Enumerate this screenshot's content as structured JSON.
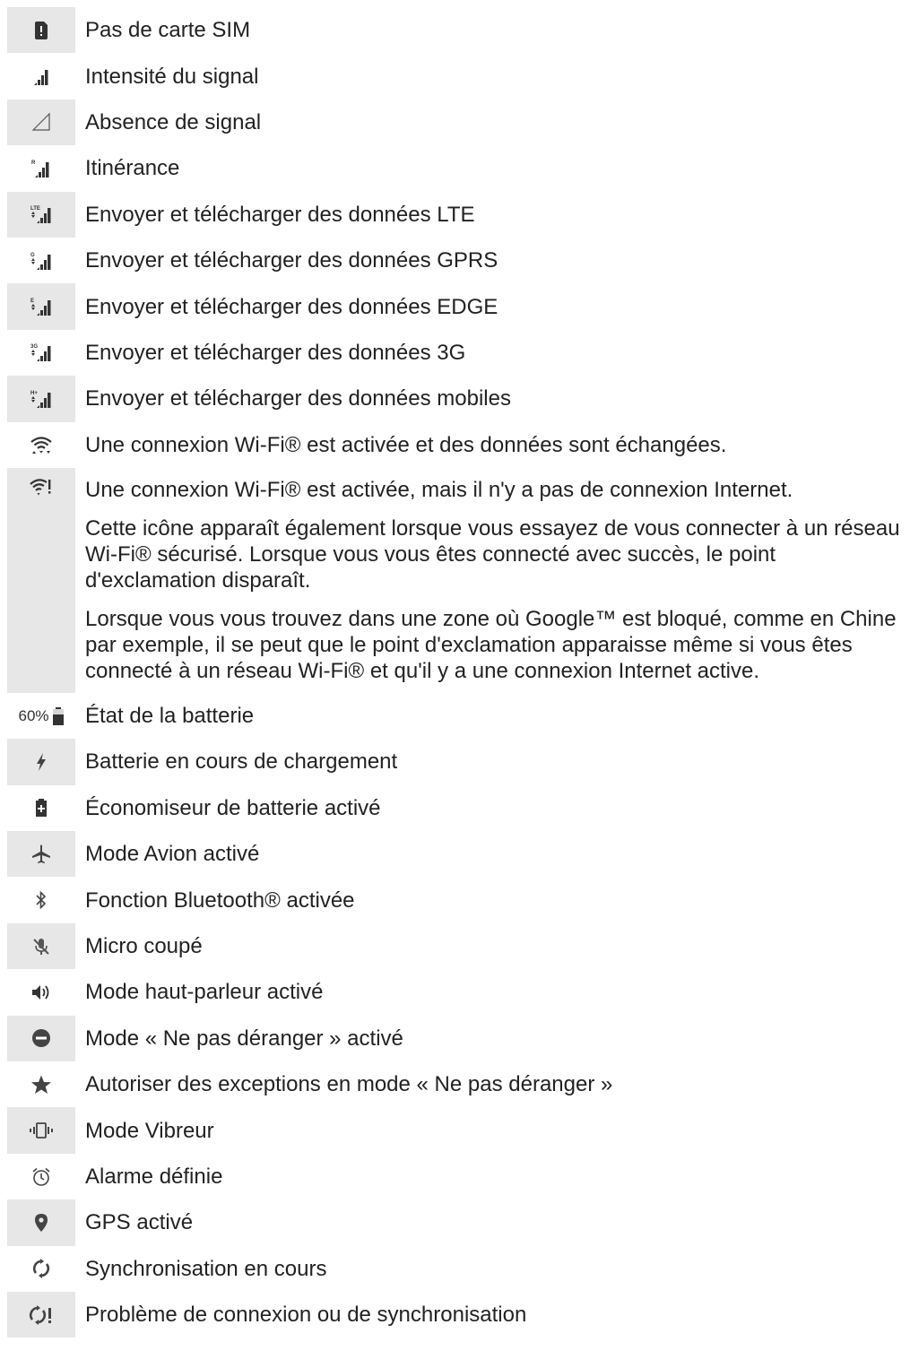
{
  "rows": [
    {
      "icon": "no-sim-card-icon",
      "shaded": true,
      "lines": [
        "Pas de carte SIM"
      ]
    },
    {
      "icon": "signal-strength-icon",
      "shaded": false,
      "lines": [
        "Intensité du signal"
      ]
    },
    {
      "icon": "no-signal-icon",
      "shaded": true,
      "lines": [
        "Absence de signal"
      ]
    },
    {
      "icon": "roaming-icon",
      "shaded": false,
      "lines": [
        "Itinérance"
      ]
    },
    {
      "icon": "lte-data-icon",
      "shaded": true,
      "lines": [
        "Envoyer et télécharger des données LTE"
      ]
    },
    {
      "icon": "gprs-data-icon",
      "shaded": false,
      "lines": [
        "Envoyer et télécharger des données GPRS"
      ]
    },
    {
      "icon": "edge-data-icon",
      "shaded": true,
      "lines": [
        "Envoyer et télécharger des données EDGE"
      ]
    },
    {
      "icon": "3g-data-icon",
      "shaded": false,
      "lines": [
        "Envoyer et télécharger des données 3G"
      ]
    },
    {
      "icon": "mobile-data-icon",
      "shaded": true,
      "lines": [
        "Envoyer et télécharger des données mobiles"
      ]
    },
    {
      "icon": "wifi-active-icon",
      "shaded": false,
      "lines": [
        "Une connexion Wi-Fi® est activée et des données sont échangées."
      ]
    },
    {
      "icon": "wifi-no-internet-icon",
      "shaded": true,
      "lines": [
        "Une connexion Wi-Fi® est activée, mais il n'y a pas de connexion Internet.",
        "Cette icône apparaît également lorsque vous essayez de vous connecter à un réseau Wi-Fi® sécurisé. Lorsque vous vous êtes connecté avec succès, le point d'exclamation disparaît.",
        "Lorsque vous vous trouvez dans une zone où Google™ est bloqué, comme en Chine par exemple, il se peut que le point d'exclamation apparaisse même si vous êtes connecté à un réseau Wi-Fi® et qu'il y a une connexion Internet active."
      ]
    },
    {
      "icon": "battery-status-icon",
      "shaded": false,
      "icon_text": "60%",
      "lines": [
        "État de la batterie"
      ]
    },
    {
      "icon": "battery-charging-icon",
      "shaded": true,
      "lines": [
        "Batterie en cours de chargement"
      ]
    },
    {
      "icon": "battery-saver-icon",
      "shaded": false,
      "lines": [
        "Économiseur de batterie activé"
      ]
    },
    {
      "icon": "airplane-mode-icon",
      "shaded": true,
      "lines": [
        "Mode Avion activé"
      ]
    },
    {
      "icon": "bluetooth-icon",
      "shaded": false,
      "lines": [
        "Fonction Bluetooth® activée"
      ]
    },
    {
      "icon": "microphone-muted-icon",
      "shaded": true,
      "lines": [
        "Micro coupé"
      ]
    },
    {
      "icon": "speakerphone-icon",
      "shaded": false,
      "lines": [
        "Mode haut-parleur activé"
      ]
    },
    {
      "icon": "do-not-disturb-icon",
      "shaded": true,
      "lines": [
        "Mode « Ne pas déranger » activé"
      ]
    },
    {
      "icon": "star-icon",
      "shaded": false,
      "lines": [
        "Autoriser des exceptions en mode « Ne pas déranger »"
      ]
    },
    {
      "icon": "vibrate-mode-icon",
      "shaded": true,
      "lines": [
        "Mode Vibreur"
      ]
    },
    {
      "icon": "alarm-icon",
      "shaded": false,
      "lines": [
        "Alarme définie"
      ]
    },
    {
      "icon": "gps-location-icon",
      "shaded": true,
      "lines": [
        "GPS activé"
      ]
    },
    {
      "icon": "sync-icon",
      "shaded": false,
      "lines": [
        "Synchronisation en cours"
      ]
    },
    {
      "icon": "sync-problem-icon",
      "shaded": true,
      "lines": [
        "Problème de connexion ou de synchronisation"
      ]
    }
  ]
}
